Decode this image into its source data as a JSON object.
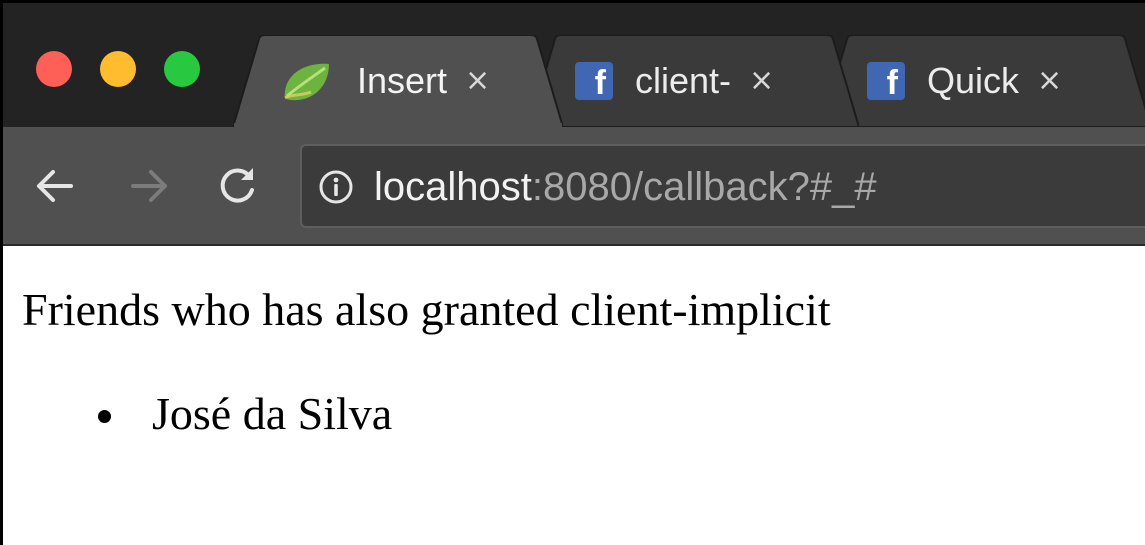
{
  "colors": {
    "tabstrip_bg": "#232323",
    "active_tab_bg": "#505050",
    "inactive_tab_bg": "#3a3a3a",
    "traffic_close": "#fe5f57",
    "traffic_minimize": "#febc2e",
    "traffic_maximize": "#28c840",
    "facebook_blue": "#4267b2",
    "spring_green": "#6db33f"
  },
  "window_controls": [
    "close",
    "minimize",
    "maximize"
  ],
  "tabs": [
    {
      "title": "Insert",
      "icon": "spring-leaf-icon",
      "active": true,
      "close_label": "×"
    },
    {
      "title": "client-",
      "icon": "facebook-icon",
      "active": false,
      "close_label": "×"
    },
    {
      "title": "Quick",
      "icon": "facebook-icon",
      "active": false,
      "close_label": "×"
    }
  ],
  "facebook_icon_letter": "f",
  "toolbar": {
    "back_icon": "back-arrow-icon",
    "forward_icon": "forward-arrow-icon",
    "reload_icon": "reload-icon",
    "info_icon": "info-icon"
  },
  "address_bar": {
    "host": "localhost",
    "rest": ":8080/callback?#_#"
  },
  "page": {
    "heading": "Friends who has also granted client-implicit",
    "friends": [
      "José da Silva"
    ]
  }
}
